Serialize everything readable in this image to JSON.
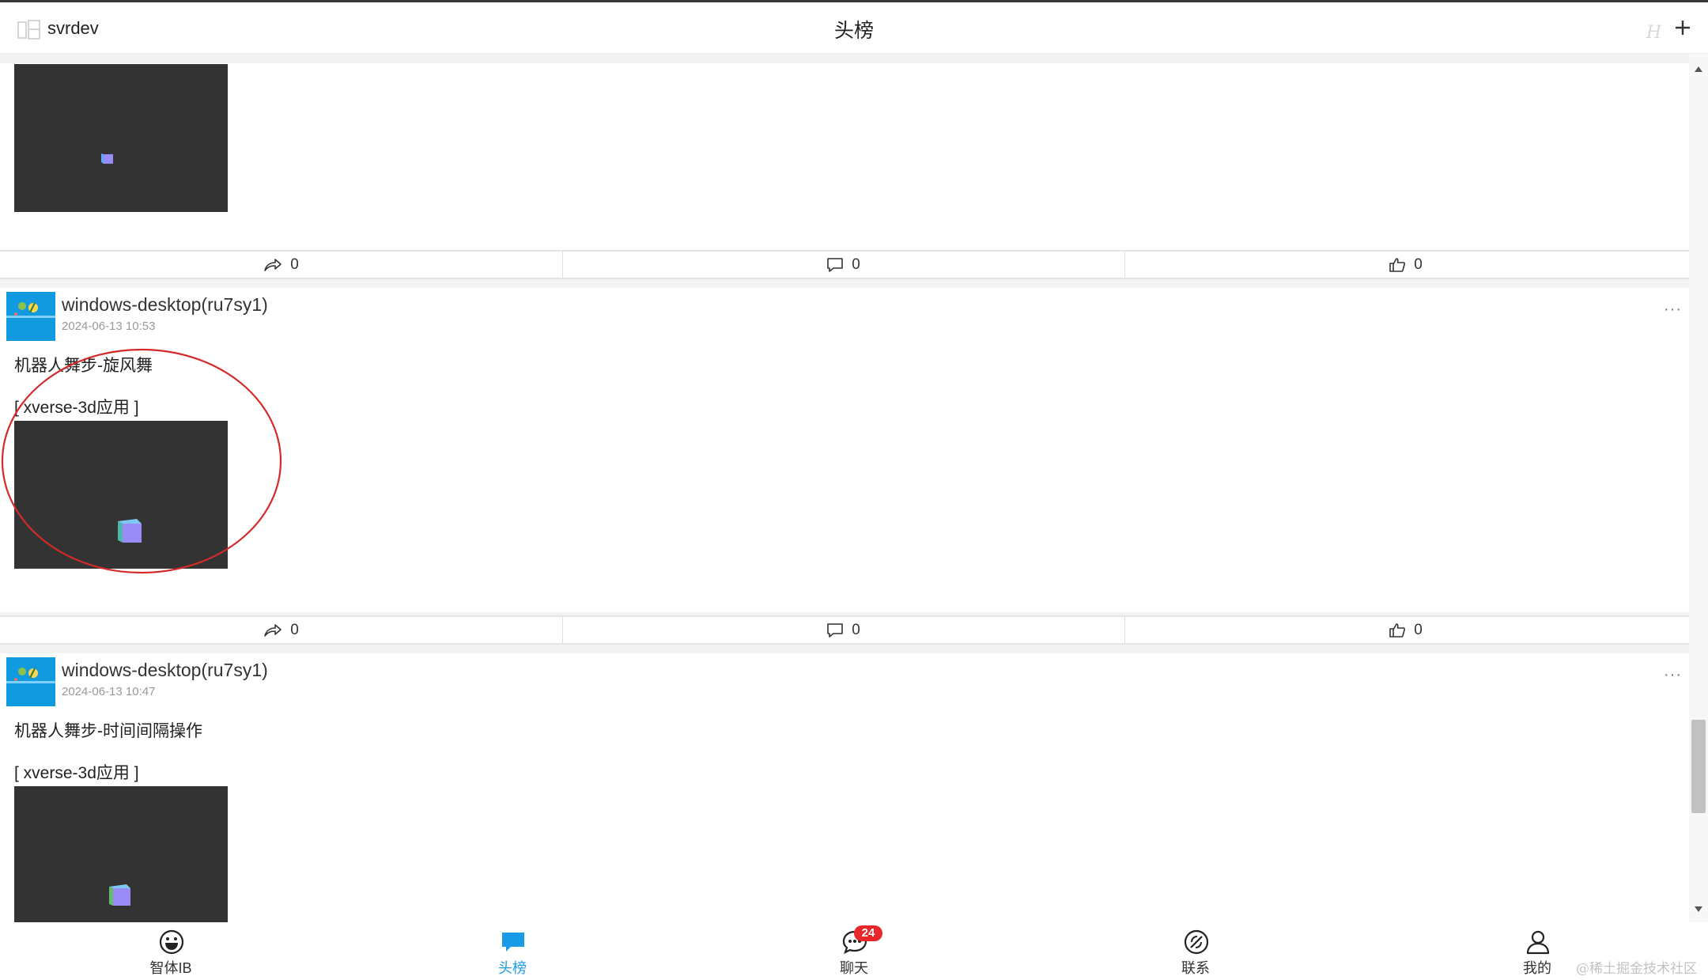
{
  "header": {
    "username": "svrdev",
    "title": "头榜",
    "h_icon": "H"
  },
  "posts": [
    {
      "actions": {
        "share": "0",
        "comment": "0",
        "like": "0"
      }
    },
    {
      "author": "windows-desktop(ru7sy1)",
      "time": "2024-06-13 10:53",
      "title": "机器人舞步-旋风舞",
      "tag": "[ xverse-3d应用 ]",
      "more": "···",
      "actions": {
        "share": "0",
        "comment": "0",
        "like": "0"
      }
    },
    {
      "author": "windows-desktop(ru7sy1)",
      "time": "2024-06-13 10:47",
      "title": "机器人舞步-时间间隔操作",
      "tag": "[ xverse-3d应用 ]",
      "more": "···"
    }
  ],
  "tabbar": {
    "tabs": [
      {
        "label": "智体IB",
        "icon": "smile-face-icon"
      },
      {
        "label": "头榜",
        "icon": "chat-bubble-icon",
        "active": true
      },
      {
        "label": "聊天",
        "icon": "chat-dots-icon",
        "badge": "24"
      },
      {
        "label": "联系",
        "icon": "compass-icon"
      },
      {
        "label": "我的",
        "icon": "user-icon"
      }
    ]
  },
  "watermark": "@稀土掘金技术社区",
  "colors": {
    "accent": "#1a9be8",
    "badge": "#e8272b",
    "thumbnail_bg": "#333333",
    "annotation": "#d42a2a"
  }
}
